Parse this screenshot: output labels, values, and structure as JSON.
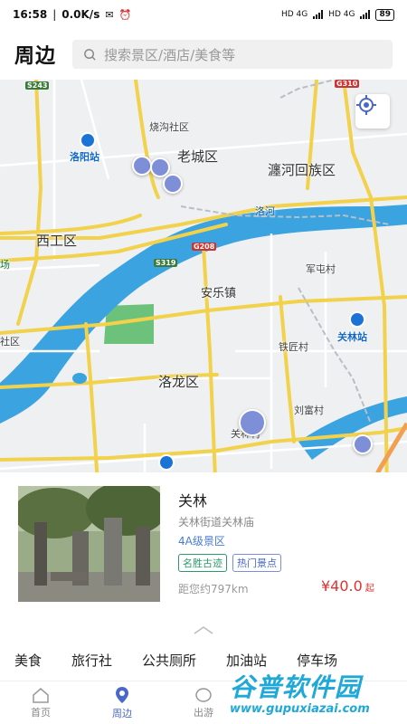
{
  "status_bar": {
    "time": "16:58",
    "speed": "0.0K/s",
    "signal1": "HD 4G",
    "signal2": "HD 4G",
    "battery": "89"
  },
  "header": {
    "title": "周边",
    "search_placeholder": "搜索景区/酒店/美食等"
  },
  "map": {
    "districts": [
      "老城区",
      "瀍河回族区",
      "西工区",
      "洛龙区"
    ],
    "towns": [
      "安乐镇"
    ],
    "villages": [
      "烧沟社区",
      "军屯村",
      "铁匠村",
      "刘富村",
      "关林村",
      "社区",
      "场"
    ],
    "rivers": [
      "洛河"
    ],
    "stations": [
      "洛阳站",
      "关林站"
    ],
    "road_badges": [
      "S243",
      "G310",
      "G208",
      "S319"
    ]
  },
  "card": {
    "name": "关林",
    "address": "关林街道关林庙",
    "grade": "4A级景区",
    "tags": [
      "名胜古迹",
      "热门景点"
    ],
    "distance": "距您约797km",
    "price": "¥40.0",
    "price_unit": "起"
  },
  "categories": [
    "美食",
    "旅行社",
    "公共厕所",
    "加油站",
    "停车场"
  ],
  "tabs": [
    {
      "label": "首页",
      "icon": "home-icon"
    },
    {
      "label": "周边",
      "icon": "location-pin-icon"
    },
    {
      "label": "出游",
      "icon": "travel-icon"
    }
  ],
  "watermark": {
    "title": "谷普软件园",
    "url": "www.gupuxiazai.com"
  },
  "colors": {
    "accent": "#4a68c8",
    "price": "#e53030",
    "road": "#f2d14b",
    "water": "#3aa3e0",
    "park": "#6cc27a"
  }
}
